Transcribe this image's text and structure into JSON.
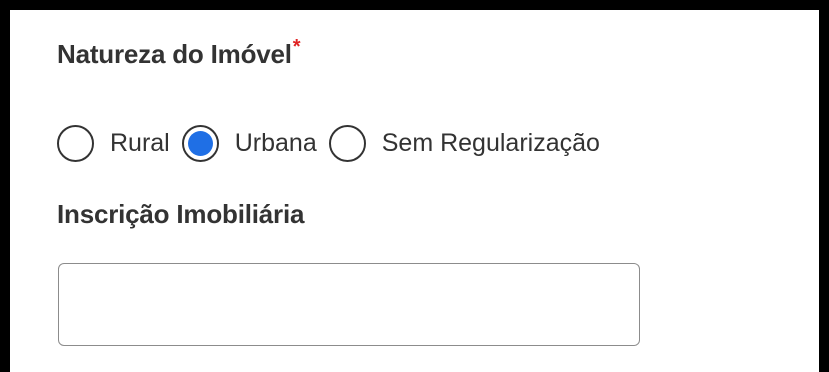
{
  "natureza": {
    "label": "Natureza do Imóvel",
    "required_mark": "*",
    "options": [
      {
        "label": "Rural",
        "checked": false
      },
      {
        "label": "Urbana",
        "checked": true
      },
      {
        "label": "Sem Regularização",
        "checked": false
      }
    ]
  },
  "inscricao": {
    "label": "Inscrição Imobiliária",
    "value": "",
    "placeholder": ""
  },
  "colors": {
    "radio_checked": "#1f6fe5",
    "required": "#e02424",
    "text": "#333333",
    "frame": "#000000"
  }
}
